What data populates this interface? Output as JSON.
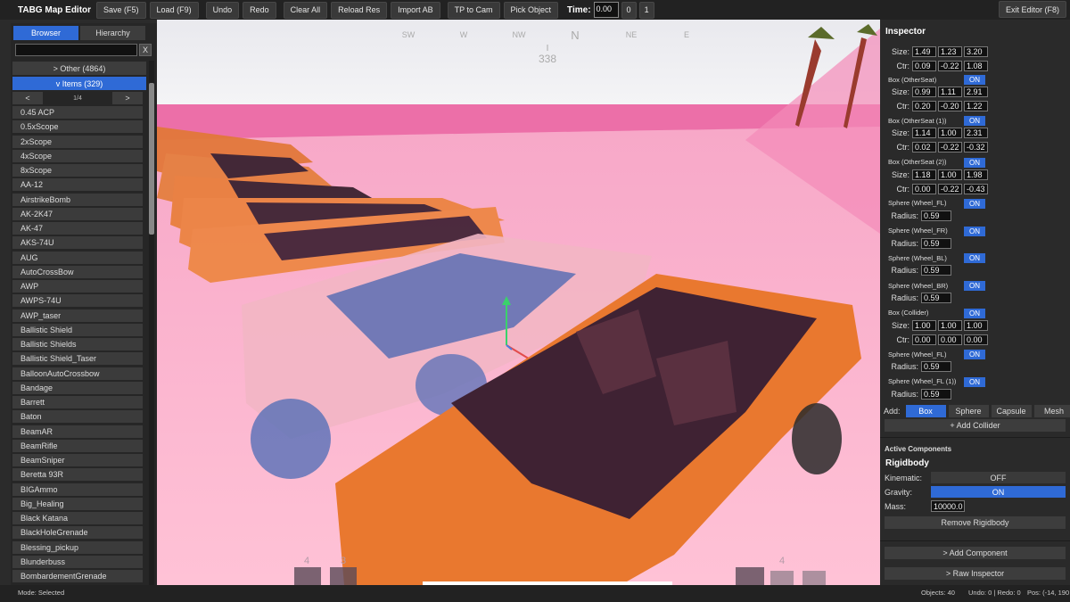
{
  "toolbar": {
    "title": "TABG Map Editor",
    "buttons": [
      "Save (F5)",
      "Load (F9)",
      "Undo",
      "Redo",
      "Clear All",
      "Reload Res",
      "Import AB",
      "TP to Cam",
      "Pick Object"
    ],
    "time_label": "Time:",
    "time_value": "0.00",
    "time_btn_0": "0",
    "time_btn_1": "1",
    "exit": "Exit Editor (F8)"
  },
  "browser": {
    "tabs": [
      "Browser",
      "Hierarchy"
    ],
    "search_clear": "X",
    "other_category": "> Other (4864)",
    "items_category": "v Items (329)",
    "prev": "<",
    "next": ">",
    "page": "1/4",
    "items": [
      "0.45 ACP",
      "0.5xScope",
      "2xScope",
      "4xScope",
      "8xScope",
      "AA-12",
      "AirstrikeBomb",
      "AK-2K47",
      "AK-47",
      "AKS-74U",
      "AUG",
      "AutoCrossBow",
      "AWP",
      "AWPS-74U",
      "AWP_taser",
      "Ballistic Shield",
      "Ballistic Shields",
      "Ballistic Shield_Taser",
      "BalloonAutoCrossbow",
      "Bandage",
      "Barrett",
      "Baton",
      "BeamAR",
      "BeamRifle",
      "BeamSniper",
      "Beretta 93R",
      "BIGAmmo",
      "Big_Healing",
      "Black Katana",
      "BlackHoleGrenade",
      "Blessing_pickup",
      "Blunderbuss",
      "BombardementGrenade"
    ]
  },
  "viewport": {
    "compass": [
      "SW",
      "W",
      "NW",
      "N",
      "NE",
      "E"
    ],
    "heading": "338",
    "hotbar_left": [
      "4",
      "3"
    ],
    "hotbar_right": "4"
  },
  "inspector": {
    "title": "Inspector",
    "size_label": "Size:",
    "ctr_label": "Ctr:",
    "radius_label": "Radius:",
    "on": "ON",
    "box0": {
      "size": [
        "1.49",
        "1.23",
        "3.20"
      ],
      "ctr": [
        "0.09",
        "-0.22",
        "1.08"
      ]
    },
    "colliders": [
      {
        "name": "Box (OtherSeat)",
        "kind": "box",
        "size": [
          "0.99",
          "1.11",
          "2.91"
        ],
        "ctr": [
          "0.20",
          "-0.20",
          "1.22"
        ]
      },
      {
        "name": "Box (OtherSeat (1))",
        "kind": "box",
        "size": [
          "1.14",
          "1.00",
          "2.31"
        ],
        "ctr": [
          "0.02",
          "-0.22",
          "-0.32"
        ]
      },
      {
        "name": "Box (OtherSeat (2))",
        "kind": "box",
        "size": [
          "1.18",
          "1.00",
          "1.98"
        ],
        "ctr": [
          "0.00",
          "-0.22",
          "-0.43"
        ]
      },
      {
        "name": "Sphere (Wheel_FL)",
        "kind": "sphere",
        "radius": "0.59"
      },
      {
        "name": "Sphere (Wheel_FR)",
        "kind": "sphere",
        "radius": "0.59"
      },
      {
        "name": "Sphere (Wheel_BL)",
        "kind": "sphere",
        "radius": "0.59"
      },
      {
        "name": "Sphere (Wheel_BR)",
        "kind": "sphere",
        "radius": "0.59"
      },
      {
        "name": "Box (Collider)",
        "kind": "box",
        "size": [
          "1.00",
          "1.00",
          "1.00"
        ],
        "ctr": [
          "0.00",
          "0.00",
          "0.00"
        ]
      },
      {
        "name": "Sphere (Wheel_FL)",
        "kind": "sphere",
        "radius": "0.59"
      },
      {
        "name": "Sphere (Wheel_FL (1))",
        "kind": "sphere",
        "radius": "0.59"
      }
    ],
    "add_label": "Add:",
    "add_types": [
      "Box",
      "Sphere",
      "Capsule",
      "Mesh"
    ],
    "add_collider": "+ Add Collider",
    "active_components": "Active Components",
    "rigidbody": "Rigidbody",
    "kinematic_label": "Kinematic:",
    "kinematic": "OFF",
    "gravity_label": "Gravity:",
    "gravity": "ON",
    "mass_label": "Mass:",
    "mass": "10000.0",
    "remove_rigidbody": "Remove Rigidbody",
    "add_component": "> Add Component",
    "raw_inspector": "> Raw Inspector"
  },
  "status": {
    "mode": "Mode: Selected",
    "objects": "Objects: 40",
    "undo": "Undo: 0 | Redo: 0",
    "pos": "Pos: (-14, 190"
  }
}
